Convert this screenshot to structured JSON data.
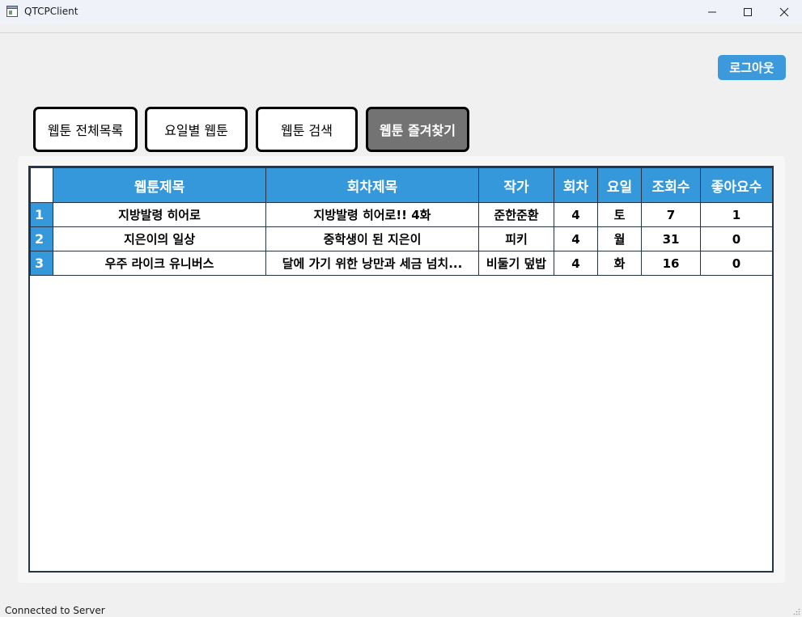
{
  "window": {
    "title": "QTCPClient"
  },
  "header": {
    "logout_label": "로그아웃"
  },
  "nav": {
    "all_label": "웹툰 전체목록",
    "day_label": "요일별 웹툰",
    "search_label": "웹툰 검색",
    "favorites_label": "웹툰 즐겨찾기",
    "active": "favorites"
  },
  "table": {
    "columns": [
      "웹툰제목",
      "회차제목",
      "작가",
      "회차",
      "요일",
      "조회수",
      "좋아요수"
    ],
    "rows": [
      {
        "num": "1",
        "title": "지방발령 히어로",
        "episode": "지방발령 히어로!! 4화",
        "author": "준한준환",
        "ep_no": "4",
        "day": "토",
        "views": "7",
        "likes": "1"
      },
      {
        "num": "2",
        "title": "지은이의 일상",
        "episode": "중학생이 된 지은이",
        "author": "피키",
        "ep_no": "4",
        "day": "월",
        "views": "31",
        "likes": "0"
      },
      {
        "num": "3",
        "title": "우주 라이크 유니버스",
        "episode": "달에 가기 위한 낭만과 세금 넘치...",
        "author": "비둘기 덮밥",
        "ep_no": "4",
        "day": "화",
        "views": "16",
        "likes": "0"
      }
    ]
  },
  "status": {
    "text": "Connected to Server"
  },
  "colors": {
    "accent": "#3598db",
    "active_tab": "#737373",
    "grid": "#24354a"
  }
}
